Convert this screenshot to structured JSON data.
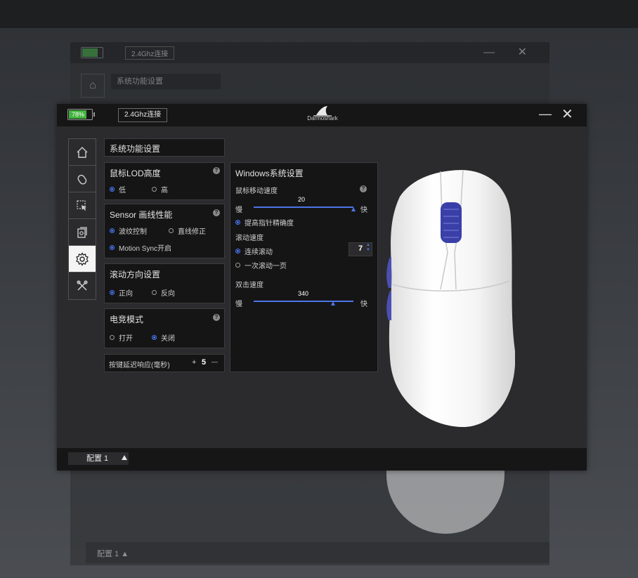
{
  "ghost": {
    "conn_label": "2.4Ghz连接",
    "title": "系统功能设置",
    "cfg_label": "配置 1"
  },
  "titlebar": {
    "battery": "78%",
    "battery_level": 0.78,
    "connection": "2.4Ghz连接",
    "logo_text": "Darmoshark",
    "minimize": "—",
    "close": "✕"
  },
  "sidebar": {
    "items": [
      {
        "name": "home",
        "icon": "home-icon",
        "active": false
      },
      {
        "name": "mouse",
        "icon": "mouse-icon",
        "active": false
      },
      {
        "name": "pointer",
        "icon": "cursor-icon",
        "active": false
      },
      {
        "name": "macro",
        "icon": "macro-icon",
        "active": false
      },
      {
        "name": "settings",
        "icon": "gear-icon",
        "active": true
      },
      {
        "name": "tools",
        "icon": "tools-icon",
        "active": false
      }
    ]
  },
  "system": {
    "header": "系统功能设置",
    "lod": {
      "title": "鼠标LOD高度",
      "options": [
        "低",
        "高"
      ],
      "selected": 0
    },
    "sensor": {
      "title": "Sensor 画线性能",
      "options": [
        "波纹控制",
        "直线修正",
        "Motion Sync开启"
      ],
      "selected": [
        0,
        2
      ]
    },
    "scroll_dir": {
      "title": "滚动方向设置",
      "options": [
        "正向",
        "反向"
      ],
      "selected": 0
    },
    "esports": {
      "title": "电竞模式",
      "options": [
        "打开",
        "关闭"
      ],
      "selected": 1
    },
    "key_delay": {
      "label": "按键延迟响应(毫秒)",
      "plus": "+",
      "value": "5",
      "minus": "—"
    }
  },
  "windows": {
    "title": "Windows系统设置",
    "move_speed": {
      "label": "鼠标移动速度",
      "value": "20",
      "slow": "慢",
      "fast": "快",
      "level": 1.0
    },
    "precision": "提高指针精确度",
    "scroll": {
      "label": "滚动速度",
      "continuous": "连续滚动",
      "value": "7",
      "one_page": "一次滚动一页"
    },
    "dblclick": {
      "label": "双击速度",
      "value": "340",
      "slow": "慢",
      "fast": "快",
      "level": 0.8
    }
  },
  "bottom": {
    "config": "配置 1"
  },
  "colors": {
    "accent": "#4c76e8",
    "battery": "#41b33c",
    "bg": "#2b2b2d",
    "panel": "#151516"
  }
}
